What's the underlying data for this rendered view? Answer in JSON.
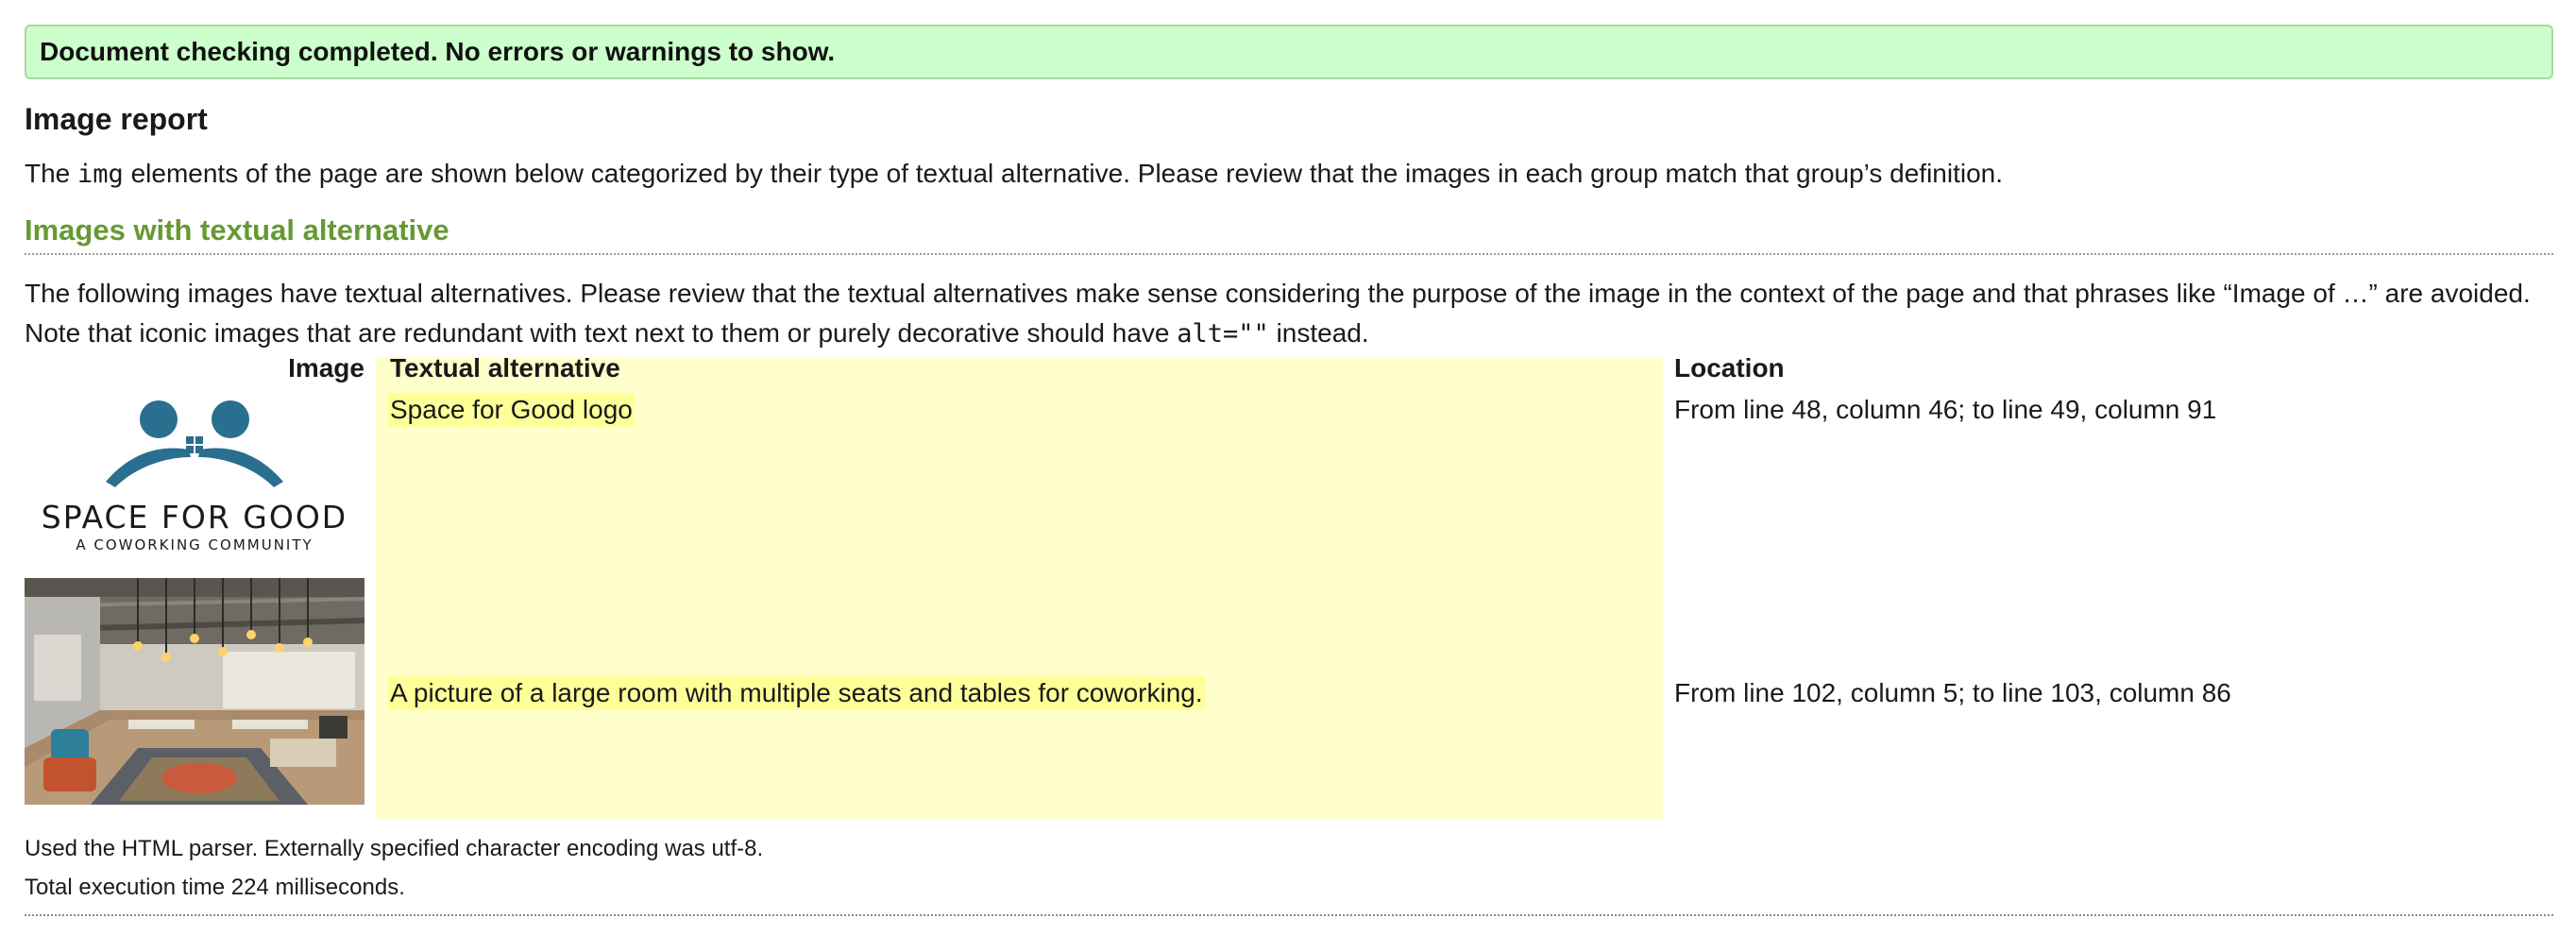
{
  "banner": {
    "message": "Document checking completed. No errors or warnings to show."
  },
  "report": {
    "title": "Image report",
    "intro_before": "The ",
    "intro_code": "img",
    "intro_after": " elements of the page are shown below categorized by their type of textual alternative. Please review that the images in each group match that group’s definition."
  },
  "section": {
    "heading": "Images with textual alternative",
    "desc_line1": "The following images have textual alternatives. Please review that the textual alternatives make sense considering the purpose of the image in the context of the page and that phrases like “Image of …” are avoided.",
    "desc_line2_before": "Note that iconic images that are redundant with text next to them or purely decorative should have ",
    "desc_line2_code": "alt=\"\"",
    "desc_line2_after": " instead."
  },
  "table": {
    "headers": {
      "image": "Image",
      "alt": "Textual alternative",
      "location": "Location"
    },
    "rows": [
      {
        "image": "space-for-good-logo",
        "alt": "Space for Good logo",
        "location": "From line 48, column 46; to line 49, column 91"
      },
      {
        "image": "coworking-room-photo",
        "alt": "A picture of a large room with multiple seats and tables for coworking.",
        "location": "From line 102, column 5; to line 103, column 86"
      }
    ]
  },
  "logo": {
    "name": "SPACE FOR GOOD",
    "tagline": "A COWORKING COMMUNITY"
  },
  "footer": {
    "parser": "Used the HTML parser. Externally specified character encoding was utf-8.",
    "timing": "Total execution time 224 milliseconds."
  },
  "colors": {
    "banner_bg": "#ccffcc",
    "section_heading": "#669933",
    "alt_column_bg": "#ffffcc",
    "alt_text_highlight": "#ffff99",
    "logo_teal": "#2a6f8f"
  }
}
